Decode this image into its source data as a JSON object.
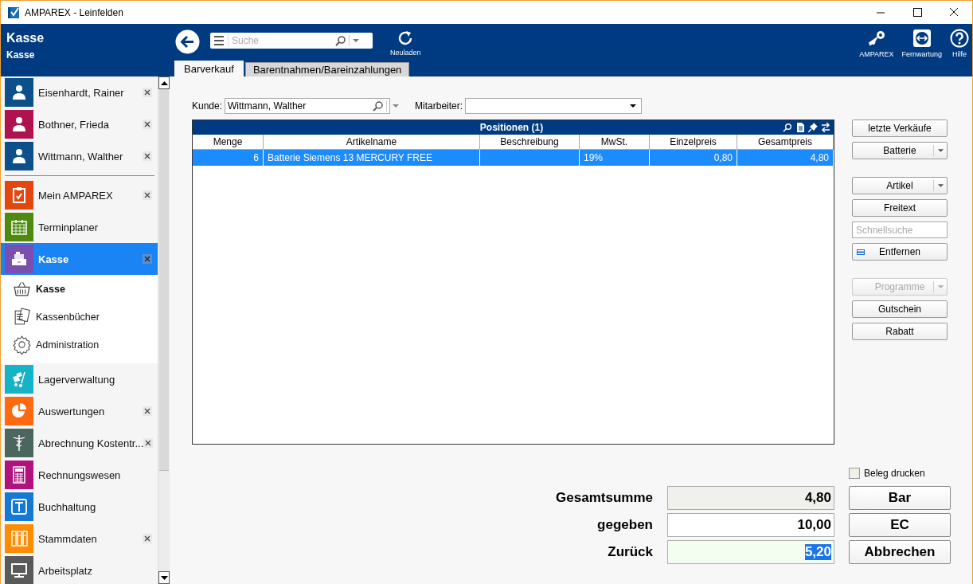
{
  "window": {
    "title": "AMPAREX - Leinfelden"
  },
  "header": {
    "title": "Kasse",
    "subtitle": "Kasse",
    "search": {
      "placeholder": "Suche"
    },
    "reload": "Neuladen",
    "tools": [
      {
        "label": "AMPAREX",
        "kind": "key"
      },
      {
        "label": "Fernwartung",
        "kind": "remote"
      },
      {
        "label": "Hilfe",
        "kind": "help"
      }
    ]
  },
  "tabs": [
    {
      "label": "Barverkauf",
      "selected": true
    },
    {
      "label": "Barentnahmen/Bareinzahlungen",
      "selected": false
    }
  ],
  "sidebar": {
    "patients": [
      {
        "name": "Eisenhardt, Rainer",
        "color": "#0d4f8b"
      },
      {
        "name": "Bothner, Frieda",
        "color": "#b0124f"
      },
      {
        "name": "Wittmann, Walther",
        "color": "#0d4f8b"
      }
    ],
    "modules": [
      {
        "label": "Mein AMPAREX",
        "kind": "clipboard",
        "color": "#e2470f",
        "closable": true,
        "selected": false
      },
      {
        "label": "Terminplaner",
        "kind": "calendar",
        "color": "#4f8a10",
        "closable": false,
        "selected": false
      },
      {
        "label": "Kasse",
        "kind": "register",
        "color": "#7a4fb0",
        "closable": true,
        "selected": true,
        "children": [
          {
            "label": "Kasse",
            "kind": "basket",
            "selected": true
          },
          {
            "label": "Kassenbücher",
            "kind": "books",
            "selected": false
          },
          {
            "label": "Administration",
            "kind": "gear",
            "selected": false
          }
        ]
      },
      {
        "label": "Lagerverwaltung",
        "kind": "cart",
        "color": "#16b3c6",
        "closable": false,
        "selected": false
      },
      {
        "label": "Auswertungen",
        "kind": "pie",
        "color": "#ff6a10",
        "closable": true,
        "selected": false
      },
      {
        "label": "Abrechnung Kostentr...",
        "kind": "staff",
        "color": "#4a665e",
        "closable": true,
        "selected": false
      },
      {
        "label": "Rechnungswesen",
        "kind": "calculator",
        "color": "#b0127e",
        "closable": false,
        "selected": false
      },
      {
        "label": "Buchhaltung",
        "kind": "ledger",
        "color": "#1478d4",
        "closable": false,
        "selected": false
      },
      {
        "label": "Stammdaten",
        "kind": "binders",
        "color": "#ff8c00",
        "closable": true,
        "selected": false
      },
      {
        "label": "Arbeitsplatz",
        "kind": "monitor",
        "color": "#5a5a5a",
        "closable": false,
        "selected": false
      }
    ]
  },
  "customer": {
    "label": "Kunde:",
    "value": "Wittmann, Walther"
  },
  "employee": {
    "label": "Mitarbeiter:"
  },
  "table": {
    "title": "Positionen (1)",
    "columns": [
      {
        "label": "Menge",
        "kind": "number"
      },
      {
        "label": "Artikelname",
        "kind": "text"
      },
      {
        "label": "Beschreibung",
        "kind": "text"
      },
      {
        "label": "MwSt.",
        "kind": "text"
      },
      {
        "label": "Einzelpreis",
        "kind": "number"
      },
      {
        "label": "Gesamtpreis",
        "kind": "number"
      }
    ],
    "rows": [
      {
        "selected": true,
        "cells": [
          "6",
          "Batterie Siemens 13 MERCURY FREE",
          null,
          "19%",
          "0,80",
          "4,80"
        ]
      }
    ]
  },
  "actions": [
    [
      {
        "label": "letzte Verkäufe",
        "kind": "button",
        "disabled": false
      },
      {
        "label": "Batterie",
        "kind": "split",
        "disabled": false
      }
    ],
    [
      {
        "label": "Artikel",
        "kind": "split",
        "disabled": false
      },
      {
        "label": "Freitext",
        "kind": "button",
        "disabled": false
      },
      {
        "placeholder": "Schnellsuche",
        "kind": "field",
        "disabled": false
      },
      {
        "label": "Entfernen",
        "kind": "remove",
        "disabled": false
      }
    ],
    [
      {
        "label": "Programme",
        "kind": "split",
        "disabled": true
      },
      {
        "label": "Gutschein",
        "kind": "button",
        "disabled": false
      },
      {
        "label": "Rabatt",
        "kind": "button",
        "disabled": false
      }
    ]
  ],
  "print_receipt": {
    "label": "Beleg drucken",
    "checked": false
  },
  "totals": [
    {
      "label": "Gesamtsumme",
      "value": "4,80",
      "kind": "readonly"
    },
    {
      "label": "gegeben",
      "value": "10,00",
      "kind": "input"
    },
    {
      "label": "Zurück",
      "value": "5,20",
      "kind": "change"
    }
  ],
  "payment_buttons": [
    "Bar",
    "EC",
    "Abbrechen"
  ]
}
